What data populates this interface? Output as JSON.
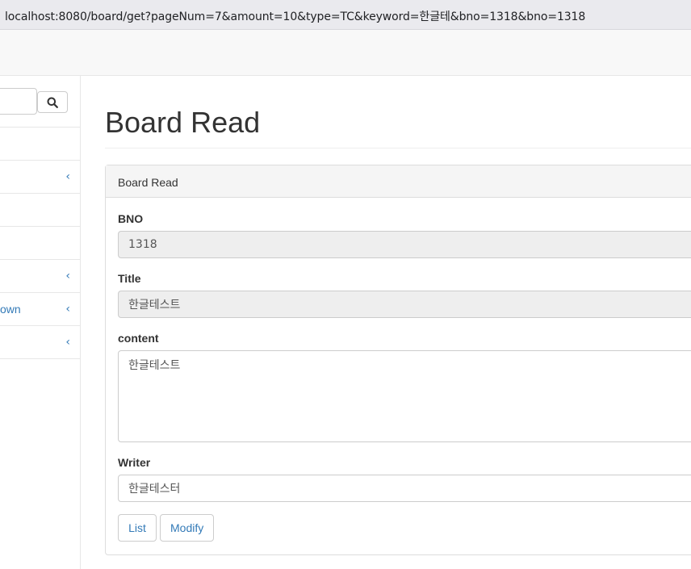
{
  "browser": {
    "url": "localhost:8080/board/get?pageNum=7&amount=10&type=TC&keyword=한글테&bno=1318&bno=1318"
  },
  "sidebar": {
    "search": {
      "placeholder": "",
      "value": ""
    },
    "items": [
      {
        "label": ""
      },
      {
        "label": ""
      },
      {
        "label": ""
      },
      {
        "label": ""
      },
      {
        "label": ""
      },
      {
        "label": "own"
      },
      {
        "label": ""
      }
    ],
    "chevron": "‹"
  },
  "main": {
    "page_title": "Board Read",
    "panel": {
      "heading": "Board Read",
      "fields": {
        "bno_label": "BNO",
        "bno_value": "1318",
        "title_label": "Title",
        "title_value": "한글테스트",
        "content_label": "content",
        "content_value": "한글테스트",
        "writer_label": "Writer",
        "writer_value": "한글테스터"
      },
      "buttons": {
        "list": "List",
        "modify": "Modify"
      }
    }
  },
  "colors": {
    "annotation_underline": "#e0201c",
    "link": "#337ab7"
  }
}
